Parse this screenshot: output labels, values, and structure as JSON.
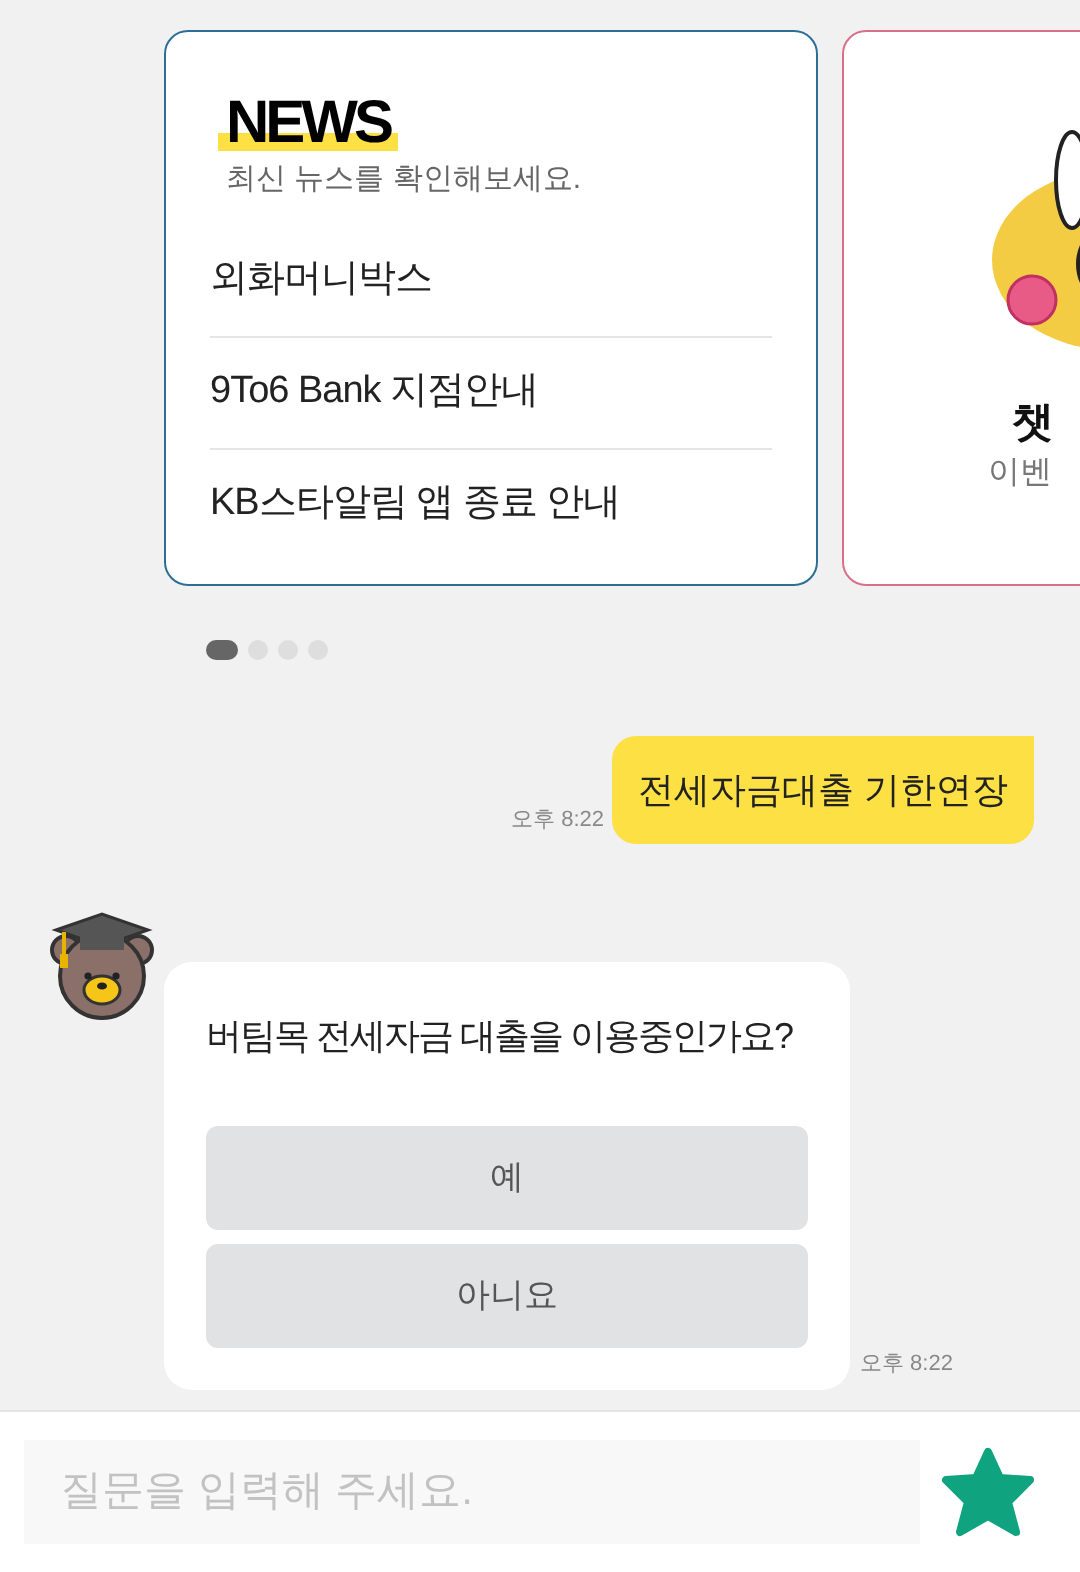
{
  "carousel": {
    "cards": [
      {
        "kind": "news",
        "title": "NEWS",
        "subtitle": "최신 뉴스를 확인해보세요.",
        "items": [
          "외화머니박스",
          "9To6 Bank 지점안내",
          "KB스타알림 앱 종료 안내"
        ]
      },
      {
        "kind": "event",
        "title": "챗",
        "subtitle": "이벤"
      }
    ],
    "dots": [
      {
        "selected": true
      },
      {
        "selected": false
      },
      {
        "selected": false
      },
      {
        "selected": false
      }
    ]
  },
  "messages": [
    {
      "kind": "user",
      "text": "전세자금대출 기한연장",
      "time": "오후 8:22"
    },
    {
      "kind": "bot",
      "text": "버팀목 전세자금 대출을 이용중인가요?",
      "options": [
        "예",
        "아니요"
      ],
      "time": "오후 8:22"
    }
  ],
  "input": {
    "placeholder": "질문을 입력해 주세요."
  }
}
